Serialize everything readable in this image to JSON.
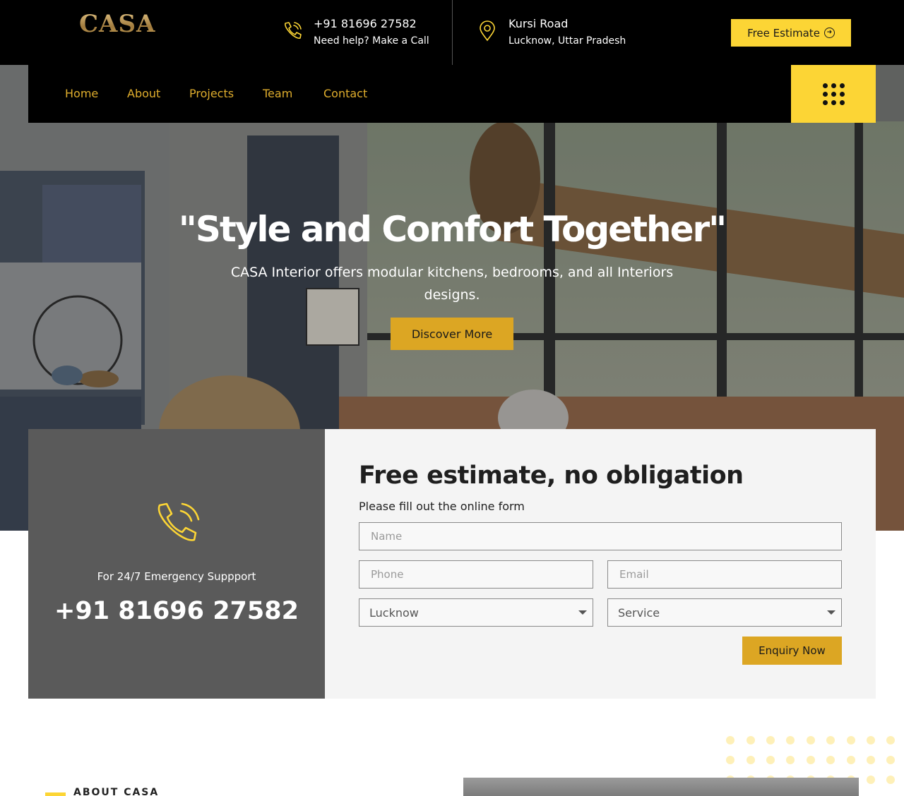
{
  "brand": {
    "logo_text": "CASA",
    "accent": "#fcd535",
    "accent_dark": "#dca623"
  },
  "topbar": {
    "phone": {
      "icon": "phone-icon",
      "number": "+91 81696 27582",
      "caption": "Need help? Make a Call"
    },
    "location": {
      "icon": "location-pin-icon",
      "title": "Kursi Road",
      "caption": "Lucknow, Uttar Pradesh"
    },
    "estimate_button": "Free Estimate"
  },
  "nav": {
    "items": [
      {
        "label": "Home"
      },
      {
        "label": "About"
      },
      {
        "label": "Projects"
      },
      {
        "label": "Team"
      },
      {
        "label": "Contact"
      }
    ],
    "menu_icon": "grid-menu-icon"
  },
  "hero": {
    "title": "\"Style and Comfort Together\"",
    "subtitle": "CASA Interior offers modular kitchens, bedrooms, and all Interiors designs.",
    "cta": "Discover More"
  },
  "support": {
    "icon": "phone-ringing-icon",
    "label": "For 24/7 Emergency Suppport",
    "phone": "+91 81696 27582"
  },
  "form": {
    "title": "Free estimate, no obligation",
    "subtitle": "Please fill out the online form",
    "name_placeholder": "Name",
    "phone_placeholder": "Phone",
    "email_placeholder": "Email",
    "city_selected": "Lucknow",
    "service_selected": "Service",
    "submit": "Enquiry Now"
  },
  "about": {
    "label": "ABOUT CASA"
  }
}
